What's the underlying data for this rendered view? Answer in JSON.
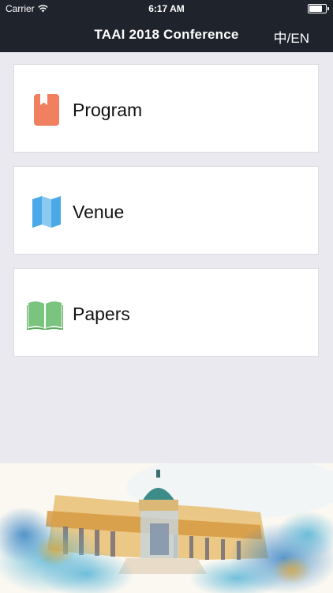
{
  "status_bar": {
    "carrier": "Carrier",
    "time": "6:17 AM",
    "battery_level": 0.9
  },
  "header": {
    "title": "TAAI 2018 Conference",
    "language_toggle": "中/EN"
  },
  "menu": [
    {
      "label": "Program",
      "icon": "bookmark-icon",
      "color": "#f08060"
    },
    {
      "label": "Venue",
      "icon": "map-icon",
      "color": "#4aa9e6"
    },
    {
      "label": "Papers",
      "icon": "open-book-icon",
      "color": "#7bc47f"
    }
  ],
  "colors": {
    "nav_background": "#1f232c",
    "page_background": "#e9e9ef"
  }
}
